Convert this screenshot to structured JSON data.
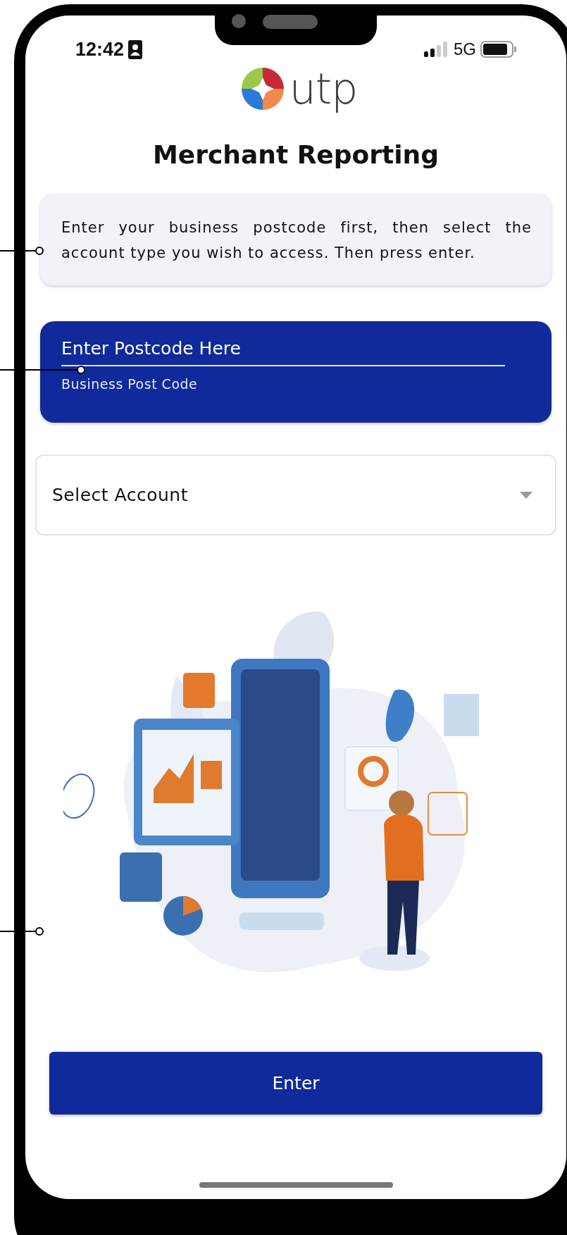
{
  "status_bar": {
    "time": "12:42",
    "network": "5G"
  },
  "logo": {
    "text": "utp"
  },
  "title": "Merchant Reporting",
  "instructions": "Enter your business postcode first, then select the account type you wish to access. Then press enter.",
  "postcode_field": {
    "placeholder": "Enter Postcode Here",
    "helper": "Business Post Code"
  },
  "account_select": {
    "label": "Select Account"
  },
  "enter_button": "Enter"
}
